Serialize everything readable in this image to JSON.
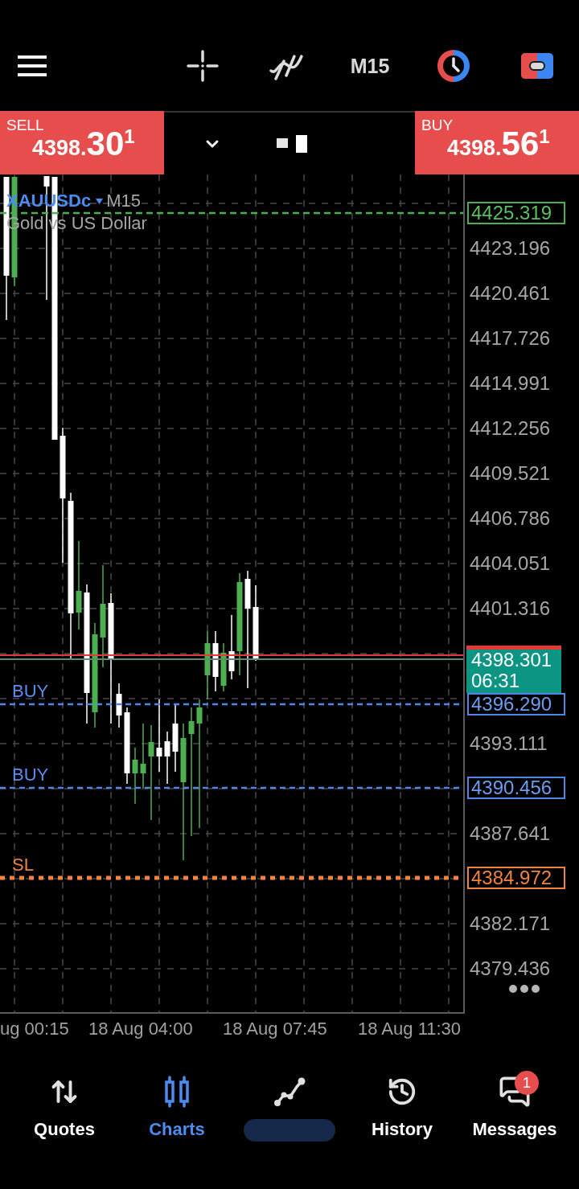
{
  "toolbar": {
    "timeframe": "M15"
  },
  "order_bar": {
    "sell": {
      "label": "SELL",
      "price_small": "4398.",
      "price_big": "30",
      "price_sup": "1"
    },
    "buy": {
      "label": "BUY",
      "price_small": "4398.",
      "price_big": "56",
      "price_sup": "1"
    }
  },
  "chart": {
    "symbol": "XAUUSDc",
    "timeframe": "M15",
    "description": "Gold vs US Dollar",
    "price_axis": [
      "4423.196",
      "4420.461",
      "4417.726",
      "4414.991",
      "4412.256",
      "4409.521",
      "4406.786",
      "4404.051",
      "4401.316",
      "4393.111",
      "4387.641",
      "4382.171",
      "4379.436"
    ],
    "lines": [
      {
        "kind": "take_profit",
        "price": "4425.319"
      },
      {
        "kind": "current",
        "price": "4398.301",
        "timer": "06:31"
      },
      {
        "kind": "order",
        "label": "BUY",
        "price": "4396.290"
      },
      {
        "kind": "order",
        "label": "BUY",
        "price": "4390.456"
      },
      {
        "kind": "stop_loss",
        "label": "SL",
        "price": "4384.972"
      }
    ],
    "time_axis": [
      "ug 00:15",
      "18 Aug 04:00",
      "18 Aug 07:45",
      "18 Aug 11:30"
    ]
  },
  "nav": [
    {
      "kind": "quotes",
      "label": "Quotes",
      "selected": false
    },
    {
      "kind": "charts",
      "label": "Charts",
      "selected": true
    },
    {
      "kind": "trade",
      "obscured": true,
      "selected": false
    },
    {
      "kind": "history",
      "label": "History",
      "selected": false
    },
    {
      "kind": "messages",
      "label": "Messages",
      "selected": false,
      "badge": "1"
    }
  ]
}
